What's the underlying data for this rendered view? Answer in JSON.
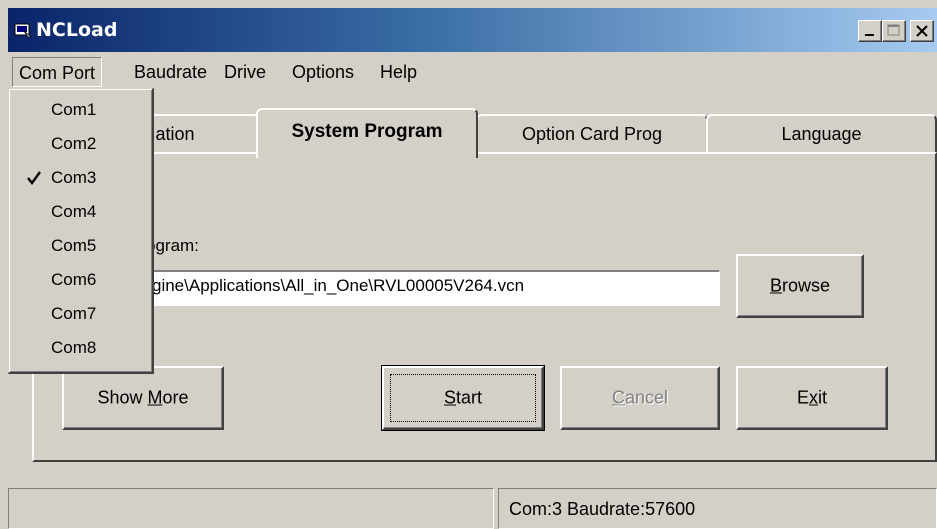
{
  "window": {
    "title": "NCLoad"
  },
  "menubar": {
    "items": [
      "Com Port",
      "Baudrate",
      "Drive",
      "Options",
      "Help"
    ]
  },
  "com_menu": {
    "items": [
      "Com1",
      "Com2",
      "Com3",
      "Com4",
      "Com5",
      "Com6",
      "Com7",
      "Com8"
    ],
    "checked": "Com3"
  },
  "tabs": {
    "items": [
      "ation",
      "System Program",
      "Option Card Prog",
      "Language"
    ],
    "selected": "System Program"
  },
  "panel": {
    "program_label": "ogram:",
    "program_path": "gine\\Applications\\All_in_One\\RVL00005V264.vcn"
  },
  "buttons": {
    "browse": "Browse",
    "show_more": "Show More",
    "start": "Start",
    "cancel": "Cancel",
    "exit": "Exit"
  },
  "statusbar": {
    "left": "",
    "right": "Com:3  Baudrate:57600"
  }
}
